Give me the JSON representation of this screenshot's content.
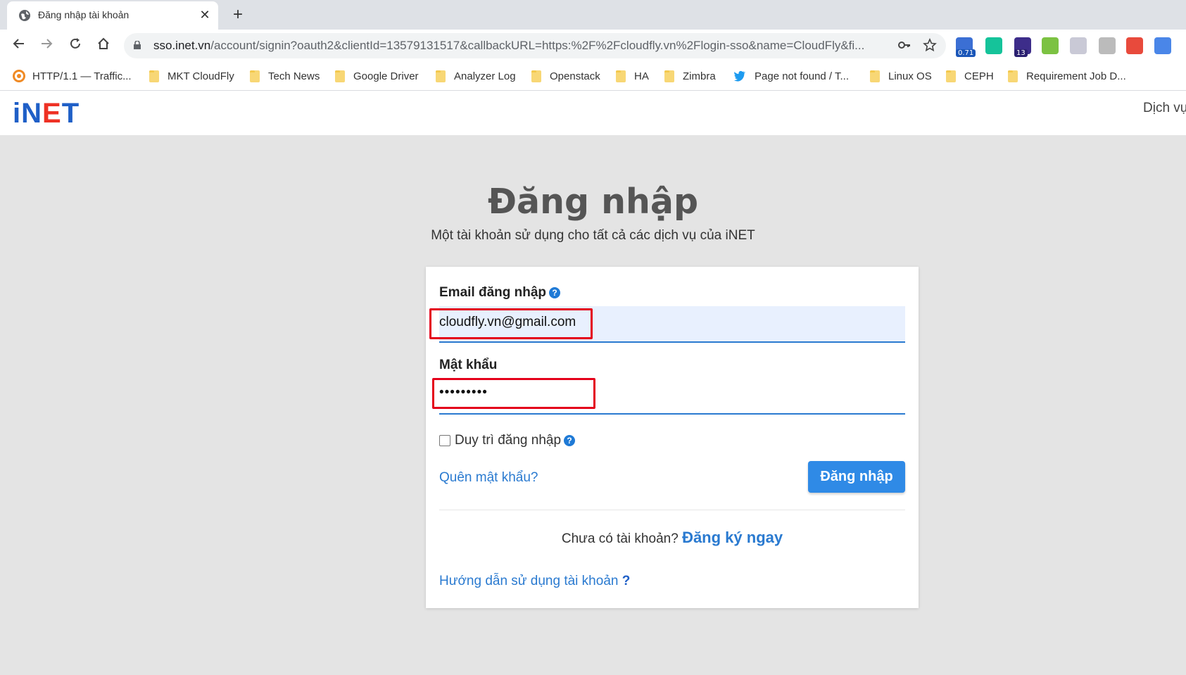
{
  "browser": {
    "tab_title": "Đăng nhập tài khoản",
    "close_glyph": "✕",
    "new_tab_glyph": "+",
    "url_host": "sso.inet.vn",
    "url_rest": "/account/signin?oauth2&clientId=13579131517&callbackURL=https:%2F%2Fcloudfly.vn%2Flogin-sso&name=CloudFly&fi...",
    "extensions": [
      {
        "name": "speed-ext-icon",
        "badge": "0.71",
        "color": "#3b6fd4"
      },
      {
        "name": "grammarly-ext-icon",
        "badge": "",
        "color": "#15c39a"
      },
      {
        "name": "graduation-ext-icon",
        "badge": "13",
        "color": "#3d2d8a"
      },
      {
        "name": "parrot-ext-icon",
        "badge": "",
        "color": "#7cc242"
      },
      {
        "name": "window-ext-icon",
        "badge": "",
        "color": "#c9c9d6"
      },
      {
        "name": "bolt-ext-icon",
        "badge": "",
        "color": "#bbbbbb"
      },
      {
        "name": "color-grid-ext-icon",
        "badge": "",
        "color": "#e84a3c"
      },
      {
        "name": "translate-ext-icon",
        "badge": "",
        "color": "#4a86e8"
      }
    ]
  },
  "bookmarks": [
    {
      "label": "HTTP/1.1 — Traffic...",
      "icon": "orange-circle"
    },
    {
      "label": "MKT CloudFly",
      "icon": "folder"
    },
    {
      "label": "Tech News",
      "icon": "folder"
    },
    {
      "label": "Google Driver",
      "icon": "folder"
    },
    {
      "label": "Analyzer Log",
      "icon": "folder"
    },
    {
      "label": "Openstack",
      "icon": "folder"
    },
    {
      "label": "HA",
      "icon": "folder"
    },
    {
      "label": "Zimbra",
      "icon": "folder"
    },
    {
      "label": "Page not found / T...",
      "icon": "twitter"
    },
    {
      "label": "Linux OS",
      "icon": "folder"
    },
    {
      "label": "CEPH",
      "icon": "folder"
    },
    {
      "label": "Requirement Job D...",
      "icon": "folder"
    }
  ],
  "site": {
    "logo_i": "i",
    "logo_n": "N",
    "logo_e": "E",
    "logo_t": "T",
    "menu_text": "Dịch vụ"
  },
  "login": {
    "title": "Đăng nhập",
    "subtitle": "Một tài khoản sử dụng cho tất cả các dịch vụ của iNET",
    "email_label": "Email đăng nhập",
    "email_value": "cloudfly.vn@gmail.com",
    "password_label": "Mật khẩu",
    "password_value": "•••••••••",
    "remember_label": "Duy trì đăng nhập",
    "help_glyph": "?",
    "forgot_label": "Quên mật khẩu?",
    "submit_label": "Đăng nhập",
    "no_account_text": "Chưa có tài khoản?",
    "signup_link": "Đăng ký ngay",
    "guide_link": "Hướng dẫn sử dụng tài khoản",
    "guide_q": "?"
  },
  "colors": {
    "accent": "#2f8ae6",
    "link": "#2a7ad0",
    "highlight_box": "#e4001b",
    "logo_red": "#ee3124",
    "logo_blue": "#1f5fc7"
  }
}
